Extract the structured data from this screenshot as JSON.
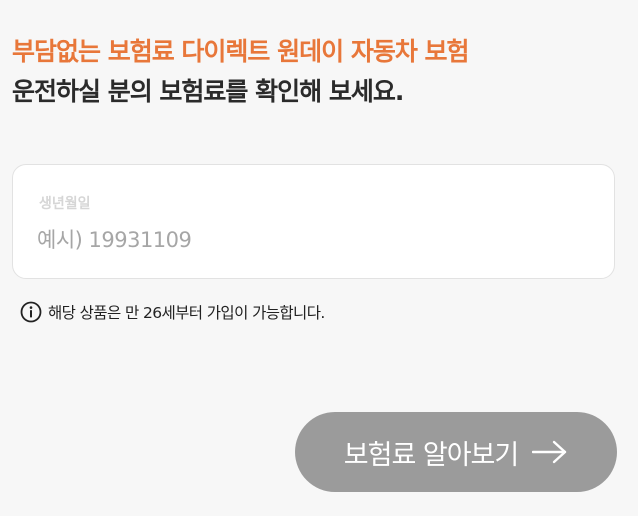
{
  "headline": {
    "accent": "부담없는 보험료 다이렉트 원데이 자동차 보험",
    "main": "운전하실 분의 보험료를 확인해 보세요."
  },
  "birth_field": {
    "label": "생년월일",
    "placeholder": "예시) 19931109",
    "value": ""
  },
  "notice": {
    "icon": "info-icon",
    "text": "해당 상품은 만 26세부터 가입이 가능합니다."
  },
  "cta": {
    "label": "보험료 알아보기",
    "icon": "arrow-right-icon"
  },
  "colors": {
    "accent": "#e8773a",
    "background": "#f7f7f7",
    "button": "#9b9b9b"
  }
}
